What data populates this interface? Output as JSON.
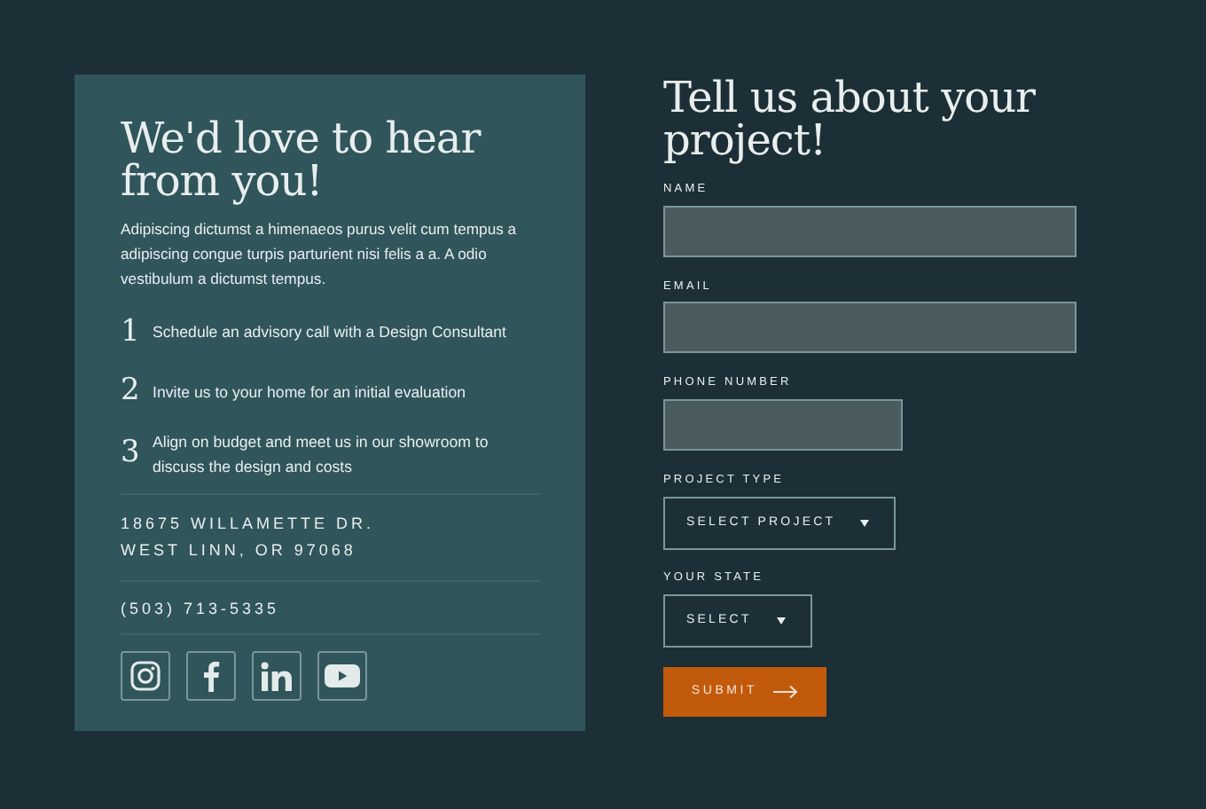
{
  "contact_panel": {
    "heading": "We'd love to hear from you!",
    "intro": "Adipiscing dictumst a himenaeos purus velit cum tempus a adipiscing congue turpis parturient nisi felis a a. A odio vestibulum a dictumst tempus.",
    "steps": [
      {
        "number": "1",
        "text": "Schedule an advisory call with a Design Consultant"
      },
      {
        "number": "2",
        "text": "Invite us to your home for an initial evaluation"
      },
      {
        "number": "3",
        "text": "Align on budget and meet us in our showroom to discuss the design and costs"
      }
    ],
    "address_lines": [
      "18675 WILLAMETTE DR.",
      "WEST LINN, OR 97068"
    ],
    "phone": "(503) 713-5335",
    "social": [
      {
        "kind": "instagram"
      },
      {
        "kind": "facebook"
      },
      {
        "kind": "linkedin"
      },
      {
        "kind": "youtube"
      }
    ]
  },
  "form": {
    "heading": "Tell us about your project!",
    "fields": [
      {
        "kind": "text",
        "label": "NAME"
      },
      {
        "kind": "email",
        "label": "EMAIL"
      },
      {
        "kind": "tel",
        "label": "PHONE NUMBER"
      },
      {
        "kind": "select",
        "label": "PROJECT TYPE",
        "value": "SELECT PROJECT"
      },
      {
        "kind": "select",
        "label": "YOUR STATE",
        "value": "SELECT"
      }
    ],
    "submit": "SUBMIT"
  }
}
